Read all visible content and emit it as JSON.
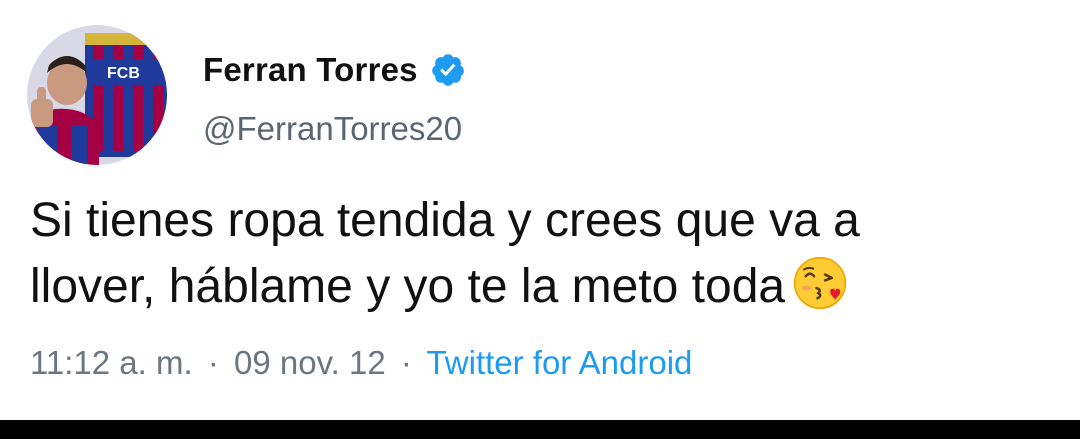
{
  "tweet": {
    "author": {
      "display_name": "Ferran Torres",
      "handle": "@FerranTorres20",
      "verified_icon": "verified-badge-icon",
      "avatar_crest_text": "FCB"
    },
    "text_line1": "Si tienes ropa tendida y crees que va a",
    "text_line2": "llover, háblame y yo te la meto toda",
    "emoji": "face-blowing-a-kiss-icon",
    "time": "11:12 a. m.",
    "separator": "·",
    "date": "09 nov. 12",
    "source": "Twitter for Android"
  },
  "colors": {
    "background": "#ffffff",
    "verified": "#1d9bf0",
    "link": "#1d9bf0",
    "muted": "#6b7680"
  }
}
